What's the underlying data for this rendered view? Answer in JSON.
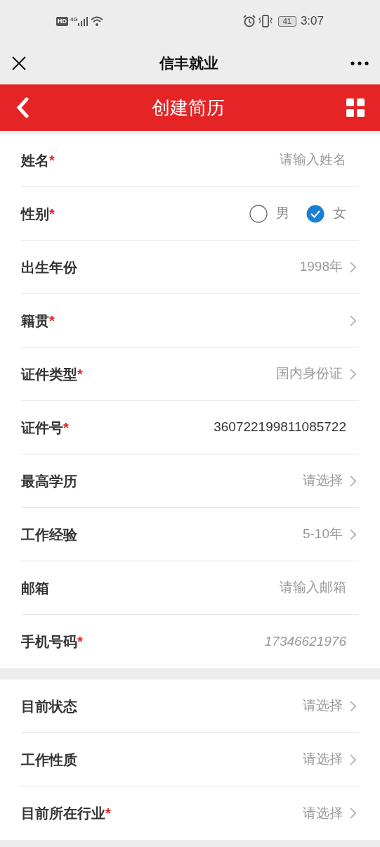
{
  "status_bar": {
    "time": "3:07",
    "network": "4G",
    "hd": "HD",
    "battery": "41"
  },
  "title_bar": {
    "title": "信丰就业"
  },
  "header": {
    "title": "创建简历"
  },
  "sections": [
    {
      "rows": [
        {
          "kind": "input",
          "label": "姓名",
          "required_mark": "*",
          "placeholder": "请输入姓名"
        },
        {
          "kind": "radio",
          "label": "性别",
          "required_mark": "*",
          "options": [
            {
              "label": "男",
              "selected": false
            },
            {
              "label": "女",
              "selected": true
            }
          ]
        },
        {
          "kind": "select",
          "label": "出生年份",
          "value": "1998年"
        },
        {
          "kind": "select",
          "label": "籍贯",
          "required_mark": "*"
        },
        {
          "kind": "select",
          "label": "证件类型",
          "required_mark": "*",
          "value": "国内身份证"
        },
        {
          "kind": "input",
          "label": "证件号",
          "required_mark": "*",
          "value": "360722199811085722"
        },
        {
          "kind": "select",
          "label": "最高学历",
          "value": "请选择"
        },
        {
          "kind": "select",
          "label": "工作经验",
          "value": "5-10年"
        },
        {
          "kind": "input",
          "label": "邮箱",
          "placeholder": "请输入邮箱"
        },
        {
          "kind": "readonly",
          "label": "手机号码",
          "required_mark": "*",
          "value": "17346621976"
        }
      ]
    },
    {
      "rows": [
        {
          "kind": "select",
          "label": "目前状态",
          "value": "请选择"
        },
        {
          "kind": "select",
          "label": "工作性质",
          "value": "请选择"
        },
        {
          "kind": "select",
          "label": "目前所在行业",
          "required_mark": "*",
          "value": "请选择"
        }
      ]
    }
  ]
}
